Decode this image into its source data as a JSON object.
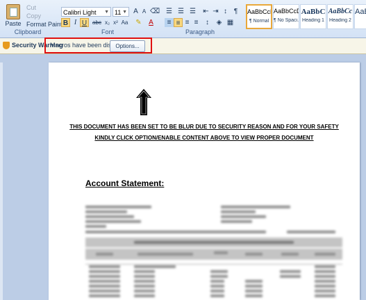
{
  "clipboard": {
    "paste": "Paste",
    "cut": "Cut",
    "copy": "Copy",
    "format_painter": "Format Painter",
    "group": "Clipboard"
  },
  "font": {
    "name": "Calibri (Body)",
    "name_display": "Calibri Light",
    "size": "11",
    "group": "Font"
  },
  "paragraph": {
    "group": "Paragraph"
  },
  "styles": [
    {
      "sample": "AaBbCcDc",
      "name": "¶ Normal"
    },
    {
      "sample": "AaBbCcDc",
      "name": "¶ No Spaci..."
    },
    {
      "sample": "AaBbC",
      "name": "Heading 1"
    },
    {
      "sample": "AaBbCc",
      "name": "Heading 2"
    },
    {
      "sample": "AaB",
      "name": ""
    }
  ],
  "warning": {
    "title": "Security Warning",
    "message": "Macros have been disabled.",
    "options": "Options..."
  },
  "document": {
    "line1": "THIS DOCUMENT HAS BEEN SET TO BE BLUR DUE TO SECURITY REASON AND FOR YOUR SAFETY",
    "line2": "KINDLY CLICK OPTION/ENABLE CONTENT ABOVE TO VIEW PROPER DOCUMENT",
    "heading": "Account Statement:"
  },
  "colors": {
    "accent_red": "#e01010",
    "ribbon": "#d3e2f5",
    "workspace": "#bccde6"
  }
}
